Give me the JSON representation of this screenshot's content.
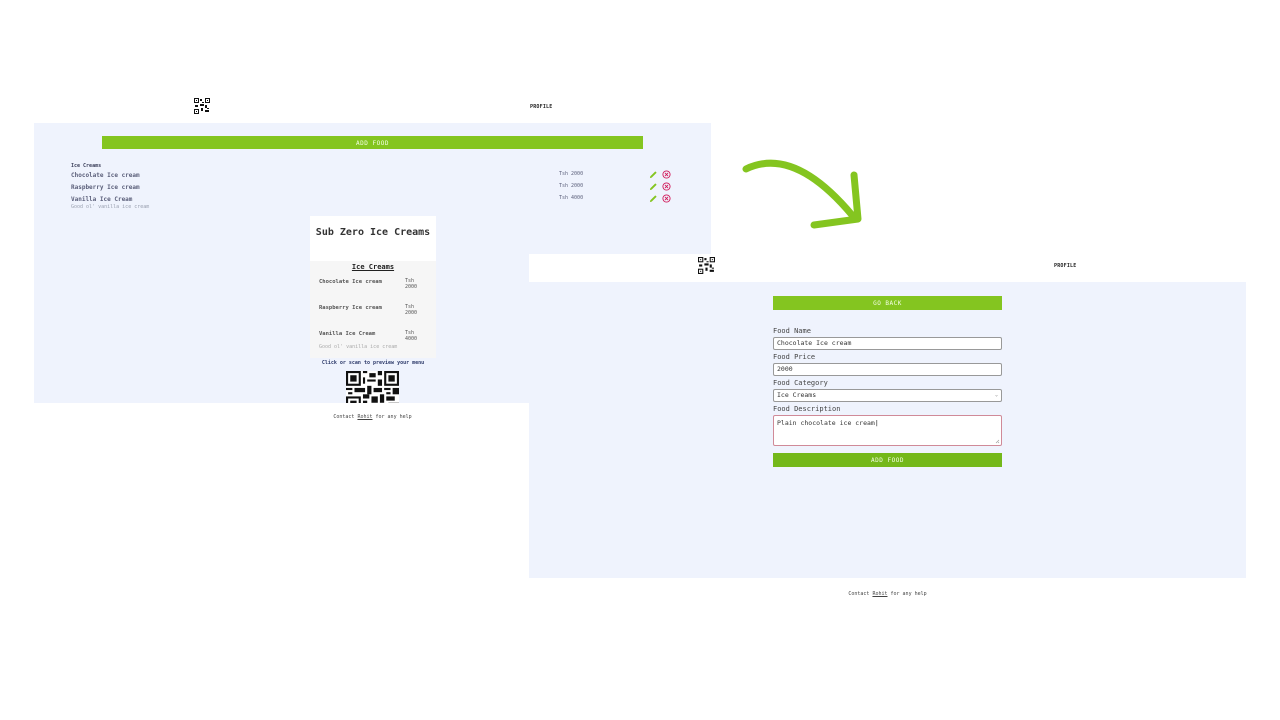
{
  "screen1": {
    "nav": {
      "profile_label": "PROFILE"
    },
    "add_food_label": "ADD FOOD",
    "category_title": "Ice Creams",
    "items": [
      {
        "name": "Chocolate Ice cream",
        "description": "",
        "price": "Tsh 2000"
      },
      {
        "name": "Raspberry Ice cream",
        "description": "",
        "price": "Tsh 2000"
      },
      {
        "name": "Vanilla Ice Cream",
        "description": "Good ol' vanilla ice cream",
        "price": "Tsh 4000"
      }
    ],
    "preview": {
      "restaurant_name": "Sub Zero Ice Creams",
      "category": "Ice Creams",
      "items": [
        {
          "name": "Chocolate Ice cream",
          "price": "Tsh 2000",
          "description": ""
        },
        {
          "name": "Raspberry Ice cream",
          "price": "Tsh 2000",
          "description": ""
        },
        {
          "name": "Vanilla Ice Cream",
          "price": "Tsh 4000",
          "description": "Good ol' vanilla ice cream"
        }
      ]
    },
    "scan_prompt": "Click or scan to preview your menu",
    "footer": {
      "prefix": "Contact ",
      "link": "Rohit",
      "suffix": " for any help"
    }
  },
  "screen2": {
    "nav": {
      "profile_label": "PROFILE"
    },
    "go_back_label": "GO BACK",
    "form": {
      "name_label": "Food Name",
      "name_value": "Chocolate Ice cream",
      "price_label": "Food Price",
      "price_value": "2000",
      "category_label": "Food Category",
      "category_value": "Ice Creams",
      "description_label": "Food Description",
      "description_value": "Plain chocolate ice cream"
    },
    "add_food_label": "ADD FOOD",
    "footer": {
      "prefix": "Contact ",
      "link": "Rohit",
      "suffix": " for any help"
    }
  },
  "colors": {
    "accent_green": "#84c520",
    "page_bg": "#eff3fd",
    "delete_red": "#d11a5a"
  }
}
